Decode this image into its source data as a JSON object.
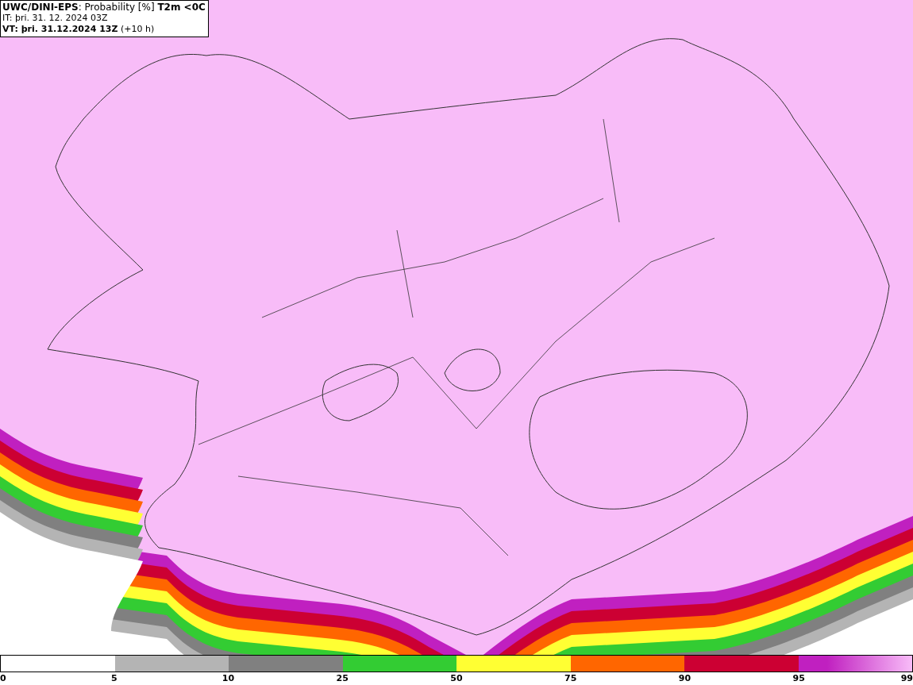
{
  "header": {
    "title": "**UWC/DINI-EPS**: Probability [%] **T2m <0C**",
    "init_time": "IT: þri. 31. 12. 2024 03Z",
    "valid_time": "**VT: þri. 31.12.2024 13Z** (+10 h)"
  },
  "legend": {
    "segments": [
      {
        "color": "#b4b4b4"
      },
      {
        "color": "#808080"
      },
      {
        "color": "#33cc33"
      },
      {
        "color": "#ffff33"
      },
      {
        "color": "#ff6600"
      },
      {
        "color": "#cc0033"
      },
      {
        "color": "#c020c0"
      }
    ],
    "ticks": [
      "0",
      "5",
      "10",
      "25",
      "50",
      "75",
      "90",
      "95",
      "99"
    ]
  }
}
